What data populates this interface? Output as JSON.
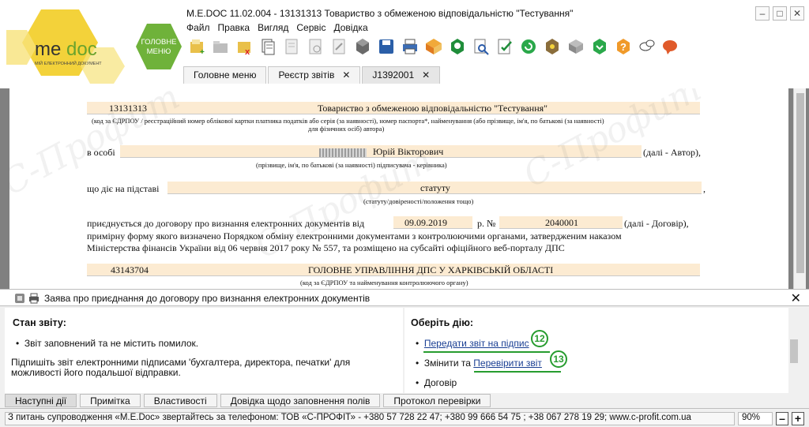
{
  "window": {
    "title": "M.E.DOC 11.02.004 - 13131313 Товариство з обмеженою відповідальністю \"Тестування\"",
    "controls": [
      "–",
      "□",
      "✕"
    ]
  },
  "logo": {
    "brand": "me doc",
    "tagline": "МІЙ ЕЛЕКТРОННИЙ ДОКУМЕНТ"
  },
  "main_menu_button": {
    "line1": "ГОЛОВНЕ",
    "line2": "МЕНЮ"
  },
  "menubar": [
    "Файл",
    "Правка",
    "Вигляд",
    "Сервіс",
    "Довідка"
  ],
  "toolbar_icons": [
    "new-doc-icon",
    "open-folder-icon",
    "delete-doc-icon",
    "copy-doc-icon",
    "edit-doc-icon",
    "view-doc-icon",
    "cut-icon",
    "settings-cubes-icon",
    "save-icon",
    "print-icon",
    "send-envelope-icon",
    "find-icon",
    "zoom-icon",
    "check-icon",
    "refresh-icon",
    "tree-icon",
    "package-icon",
    "download-icon",
    "help-icon",
    "chat-icon",
    "feedback-icon"
  ],
  "tabs": [
    {
      "label": "Головне меню",
      "closable": false,
      "active": false
    },
    {
      "label": "Реєстр звітів",
      "closable": true,
      "active": false
    },
    {
      "label": "J1392001",
      "closable": true,
      "active": true
    }
  ],
  "document": {
    "edrpou": "13131313",
    "company_name": "Товариство з обмеженою відповідальністю \"Тестування\"",
    "hint_company": "(код за ЄДРПОУ / реєстраційний номер облікової картки  платника  податків або серія (за наявності), номер паспорта*, найменування (або прізвище, ім'я, по батькові (за наявності)",
    "hint_company2": "для фізичних осіб) автора)",
    "person_prefix": "в особі",
    "person_name": "Юрій Вікторович",
    "person_suffix": "(далі - Автор),",
    "hint_person": "(прізвище, ім'я, по батькові (за наявності)  підписувача - керівника)",
    "basis_prefix": "що діє на підставі",
    "basis_value": "статуту",
    "basis_suffix": ",",
    "hint_basis": "(статуту/довіреності/положення тощо)",
    "contract_prefix": "приєднується до договору про визнання електронних документів від",
    "contract_date": "09.09.2019",
    "contract_no_label": "р. №",
    "contract_no": "2040001",
    "contract_suffix": "(далі - Договір),",
    "paragraph_line1": "примірну форму якого визначено Порядком обміну електронними документами з контролюючими органами, затвердженим наказом",
    "paragraph_line2": "Міністерства фінансів України від 06 червня 2017 року № 557, та розміщено  на субсайті офіційного веб-порталу ДПС",
    "authority_code": "43143704",
    "authority_name": "ГОЛОВНЕ УПРАВЛІННЯ ДПС У ХАРКІВСЬКІЙ ОБЛАСТІ",
    "hint_authority": "(код за ЄДРПОУ та найменування контролюючого органу)"
  },
  "report_strip": {
    "title": "Заява про приєднання до договору про визнання електронних документів",
    "close": "✕"
  },
  "status_panel": {
    "heading": "Стан звіту:",
    "bullet": "Звіт заповнений та не містить помилок.",
    "advice_line1": "Підпишіть звіт електронними підписами 'бухгалтера, директора, печатки' для",
    "advice_line2": "можливості його подальшої відправки."
  },
  "actions_panel": {
    "heading": "Оберіть дію:",
    "action1_link": "Передати звіт на підпис",
    "action2_prefix": "Змінити та ",
    "action2_link": "Перевірити звіт",
    "action3": "Дoговір",
    "badge1": "12",
    "badge2": "13"
  },
  "bottom_tabs": [
    "Наступні дії",
    "Примітка",
    "Властивості",
    "Довідка щодо заповнення полів",
    "Протокол перевірки"
  ],
  "statusbar": {
    "text": "З питань супроводження «M.E.Doc» звертайтесь за телефоном: ТОВ «С-ПРОФІТ» - +380 57 728 22 47; +380 99 666 54 75 ; +38 067 278 19 29; www.c-profit.com.ua",
    "zoom": "90%",
    "minus": "–",
    "plus": "+"
  },
  "colors": {
    "field_bg": "#fcebd2",
    "accent_green": "#279c2f",
    "link": "#1a3f93",
    "logo_yellow": "#f3d23a"
  }
}
